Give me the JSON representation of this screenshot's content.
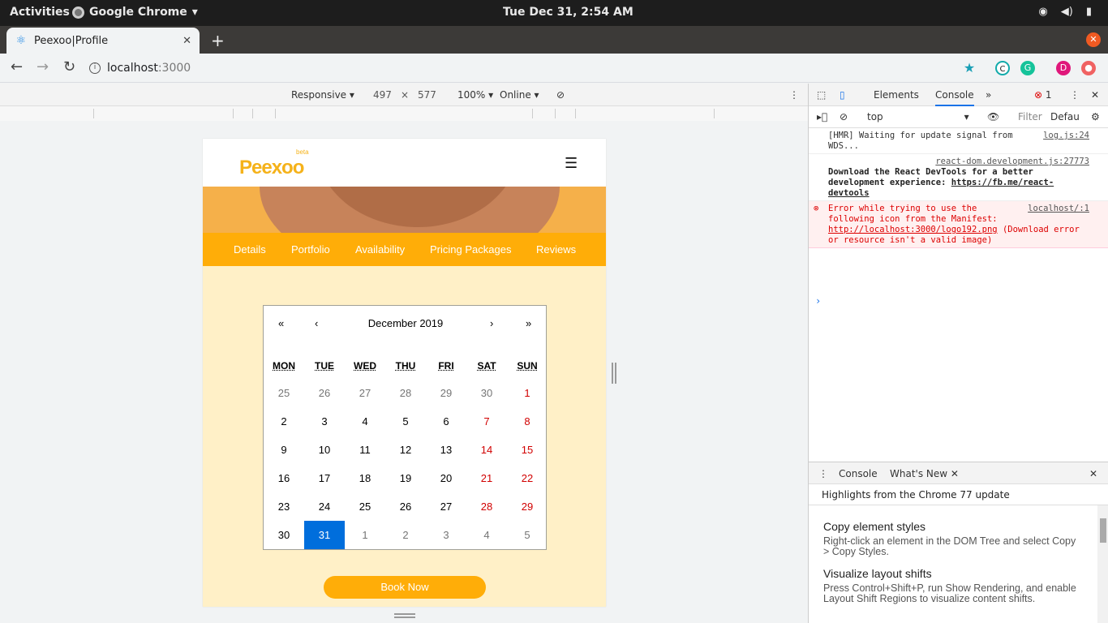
{
  "os": {
    "activities": "Activities",
    "app_name": "Google Chrome",
    "clock": "Tue Dec 31,  2:54 AM"
  },
  "browser": {
    "tab_title": "Peexoo|Profile",
    "url_host": "localhost",
    "url_port": ":3000",
    "profile_initial": "D"
  },
  "device_toolbar": {
    "mode": "Responsive",
    "width": "497",
    "height": "577",
    "zoom": "100%",
    "network": "Online"
  },
  "site": {
    "logo": "Peexoo",
    "logo_badge": "beta",
    "tabs": [
      "Details",
      "Portfolio",
      "Availability",
      "Pricing Packages",
      "Reviews"
    ],
    "book_button": "Book Now"
  },
  "calendar": {
    "month_label": "December 2019",
    "nav": [
      "«",
      "‹",
      "›",
      "»"
    ],
    "weekdays": [
      "MON",
      "TUE",
      "WED",
      "THU",
      "FRI",
      "SAT",
      "SUN"
    ],
    "weeks": [
      [
        "25",
        "26",
        "27",
        "28",
        "29",
        "30",
        "1"
      ],
      [
        "2",
        "3",
        "4",
        "5",
        "6",
        "7",
        "8"
      ],
      [
        "9",
        "10",
        "11",
        "12",
        "13",
        "14",
        "15"
      ],
      [
        "16",
        "17",
        "18",
        "19",
        "20",
        "21",
        "22"
      ],
      [
        "23",
        "24",
        "25",
        "26",
        "27",
        "28",
        "29"
      ],
      [
        "30",
        "31",
        "1",
        "2",
        "3",
        "4",
        "5"
      ]
    ],
    "selected_day": "31"
  },
  "devtools": {
    "tabs": [
      "Elements",
      "Console"
    ],
    "active_tab": "Console",
    "error_count": "1",
    "context": "top",
    "filter_placeholder": "Filter",
    "levels": "Defau",
    "messages": [
      {
        "text": "[HMR] Waiting for update signal from WDS...",
        "source": "log.js:24"
      },
      {
        "source": "react-dom.development.js:27773",
        "text": "Download the React DevTools for a better development experience: ",
        "link": "https://fb.me/react-devtools"
      },
      {
        "source": "localhost/:1",
        "text": "Error while trying to use the following icon from the Manifest: ",
        "link": "http://localhost:3000/logo192.png",
        "tail": " (Download error or resource isn't a valid image)"
      }
    ],
    "drawer_tabs": [
      "Console",
      "What's New"
    ],
    "highlights": "Highlights from the Chrome 77 update",
    "whats_new": [
      {
        "title": "Copy element styles",
        "body": "Right-click an element in the DOM Tree and select Copy > Copy Styles."
      },
      {
        "title": "Visualize layout shifts",
        "body": "Press Control+Shift+P, run Show Rendering, and enable Layout Shift Regions to visualize content shifts."
      }
    ]
  }
}
